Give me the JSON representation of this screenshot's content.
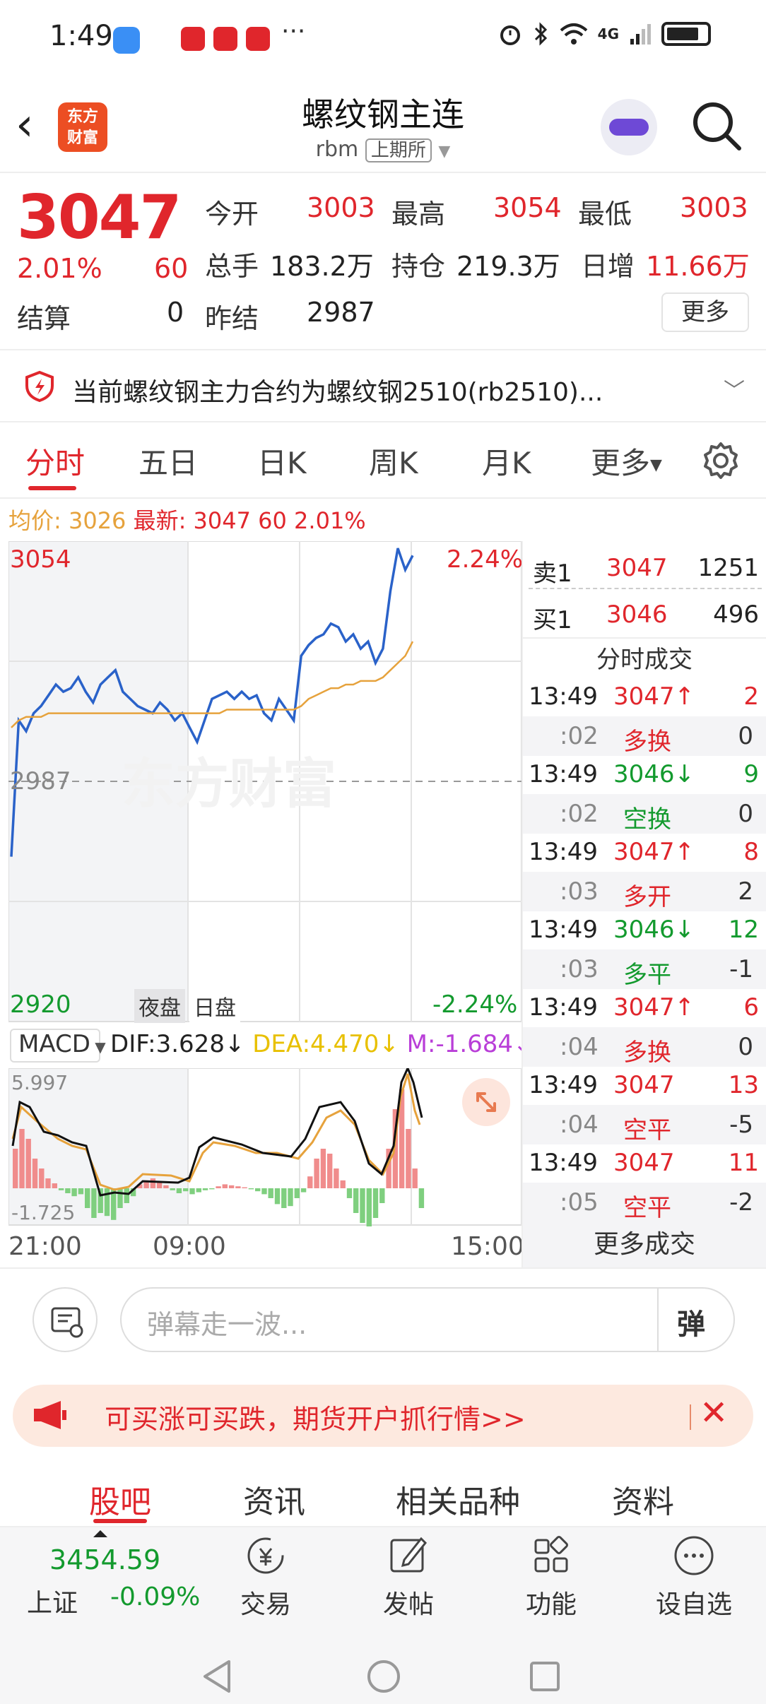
{
  "status_bar": {
    "time": "1:49",
    "more": "···",
    "network": "4G"
  },
  "header": {
    "logo_text_1": "东方",
    "logo_text_2": "财富",
    "title": "螺纹钢主连",
    "code": "rbm",
    "exchange": "上期所"
  },
  "quote": {
    "price": "3047",
    "change_pct": "2.01%",
    "change": "60",
    "settle_label": "结算",
    "settle_value": "0",
    "open_label": "今开",
    "open": "3003",
    "high_label": "最高",
    "high": "3054",
    "low_label": "最低",
    "low": "3003",
    "volume_label": "总手",
    "volume": "183.2万",
    "oi_label": "持仓",
    "oi": "219.3万",
    "daily_inc_label": "日增",
    "daily_inc": "11.66万",
    "prev_settle_label": "昨结",
    "prev_settle": "2987",
    "more_label": "更多"
  },
  "notice": {
    "text": "当前螺纹钢主力合约为螺纹钢2510(rb2510)..."
  },
  "tabs": [
    "分时",
    "五日",
    "日K",
    "周K",
    "月K",
    "更多"
  ],
  "avg_row": {
    "avg_label": "均价:",
    "avg": "3026",
    "latest_label": "最新:",
    "latest": "3047",
    "chg": "60",
    "pct": "2.01%"
  },
  "chart_labels": {
    "top_price": "3054",
    "top_pct": "2.24%",
    "mid_price": "2987",
    "bottom_price": "2920",
    "bottom_pct": "-2.24%",
    "night_session": "夜盘",
    "day_session": "日盘",
    "watermark": "东方财富",
    "time_start": "21:00",
    "time_mid": "09:00",
    "time_end": "15:00"
  },
  "macd": {
    "selector": "MACD",
    "dif": "DIF:3.628",
    "dea": "DEA:4.470",
    "m": "M:-1.684",
    "top": "5.997",
    "bottom": "-1.725"
  },
  "chart_data": {
    "type": "line",
    "y_range": [
      2920,
      3054
    ],
    "prev_settle": 2987,
    "series": [
      {
        "values": [
          2966,
          3004,
          3001,
          3006,
          3008,
          3011,
          3014,
          3012,
          3013,
          3016,
          3012,
          3009,
          3014,
          3016,
          3018,
          3012,
          3010,
          3008,
          3007,
          3006,
          3009,
          3007,
          3004,
          3006,
          3002,
          2998,
          3004,
          3010,
          3011,
          3012,
          3010,
          3012,
          3010,
          3011,
          3006,
          3004,
          3010,
          3007,
          3004,
          3022,
          3025,
          3027,
          3028,
          3031,
          3030,
          3026,
          3028,
          3024,
          3026,
          3020,
          3024,
          3040,
          3052,
          3046,
          3050
        ]
      },
      {
        "values": [
          3002,
          3004,
          3005,
          3005,
          3005,
          3006,
          3006,
          3006,
          3006,
          3006,
          3006,
          3006,
          3006,
          3006,
          3006,
          3006,
          3006,
          3006,
          3006,
          3006,
          3006,
          3006,
          3006,
          3006,
          3006,
          3006,
          3006,
          3006,
          3006,
          3007,
          3007,
          3007,
          3007,
          3007,
          3007,
          3007,
          3007,
          3007,
          3007,
          3008,
          3010,
          3011,
          3012,
          3013,
          3013,
          3014,
          3014,
          3015,
          3015,
          3015,
          3016,
          3018,
          3020,
          3022,
          3026
        ]
      }
    ]
  },
  "order_book": [
    {
      "label": "卖1",
      "price": "3047",
      "qty": "1251"
    },
    {
      "label": "买1",
      "price": "3046",
      "qty": "496"
    }
  ],
  "trades_title": "分时成交",
  "trades": [
    {
      "time": "13:49",
      "price": "3047↑",
      "qty": "2",
      "sec": ":02",
      "type": "多换",
      "oi": "0",
      "c": "red",
      "tc": "red"
    },
    {
      "time": "13:49",
      "price": "3046↓",
      "qty": "9",
      "sec": ":02",
      "type": "空换",
      "oi": "0",
      "c": "green",
      "tc": "green"
    },
    {
      "time": "13:49",
      "price": "3047↑",
      "qty": "8",
      "sec": ":03",
      "type": "多开",
      "oi": "2",
      "c": "red",
      "tc": "red"
    },
    {
      "time": "13:49",
      "price": "3046↓",
      "qty": "12",
      "sec": ":03",
      "type": "多平",
      "oi": "-1",
      "c": "green",
      "tc": "green"
    },
    {
      "time": "13:49",
      "price": "3047↑",
      "qty": "6",
      "sec": ":04",
      "type": "多换",
      "oi": "0",
      "c": "red",
      "tc": "red"
    },
    {
      "time": "13:49",
      "price": "3047",
      "qty": "13",
      "sec": ":04",
      "type": "空平",
      "oi": "-5",
      "c": "red",
      "tc": "red"
    },
    {
      "time": "13:49",
      "price": "3047",
      "qty": "11",
      "sec": ":05",
      "type": "空平",
      "oi": "-2",
      "c": "red",
      "tc": "red"
    }
  ],
  "more_trades": "更多成交",
  "danmaku": {
    "placeholder": "弹幕走一波...",
    "button": "弹"
  },
  "banner": {
    "text": "可买涨可买跌，期货开户抓行情>>"
  },
  "bottom_tabs": [
    "股吧",
    "资讯",
    "相关品种",
    "资料"
  ],
  "index": {
    "value": "3454.59",
    "name": "上证",
    "pct": "-0.09%"
  },
  "nav": [
    "交易",
    "发帖",
    "功能",
    "设自选"
  ],
  "colors": {
    "red": "#e0262c",
    "green": "#139a2e",
    "blue": "#2a62c9",
    "avg": "#e6a23c"
  }
}
